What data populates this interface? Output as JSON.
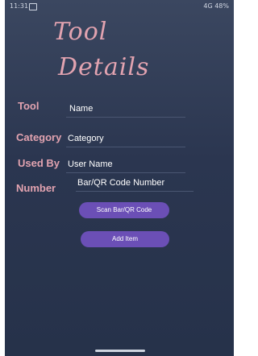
{
  "status_bar": {
    "time": "11:31",
    "right_text": "4G 48%"
  },
  "page": {
    "title_line1": "Tool",
    "title_line2": "Details"
  },
  "form": {
    "tool_label": "Tool",
    "tool_value": "Name",
    "category_label": "Category",
    "category_value": "Category",
    "used_by_label": "Used By",
    "used_by_value": "User Name",
    "number_label": "Number",
    "number_value": "Bar/QR Code Number"
  },
  "buttons": {
    "scan_label": "Scan Bar/QR Code",
    "add_label": "Add Item"
  },
  "colors": {
    "background_top": "#3b4760",
    "background_bottom": "#26324a",
    "label": "#e2a3b0",
    "button": "#6b4fb6"
  }
}
